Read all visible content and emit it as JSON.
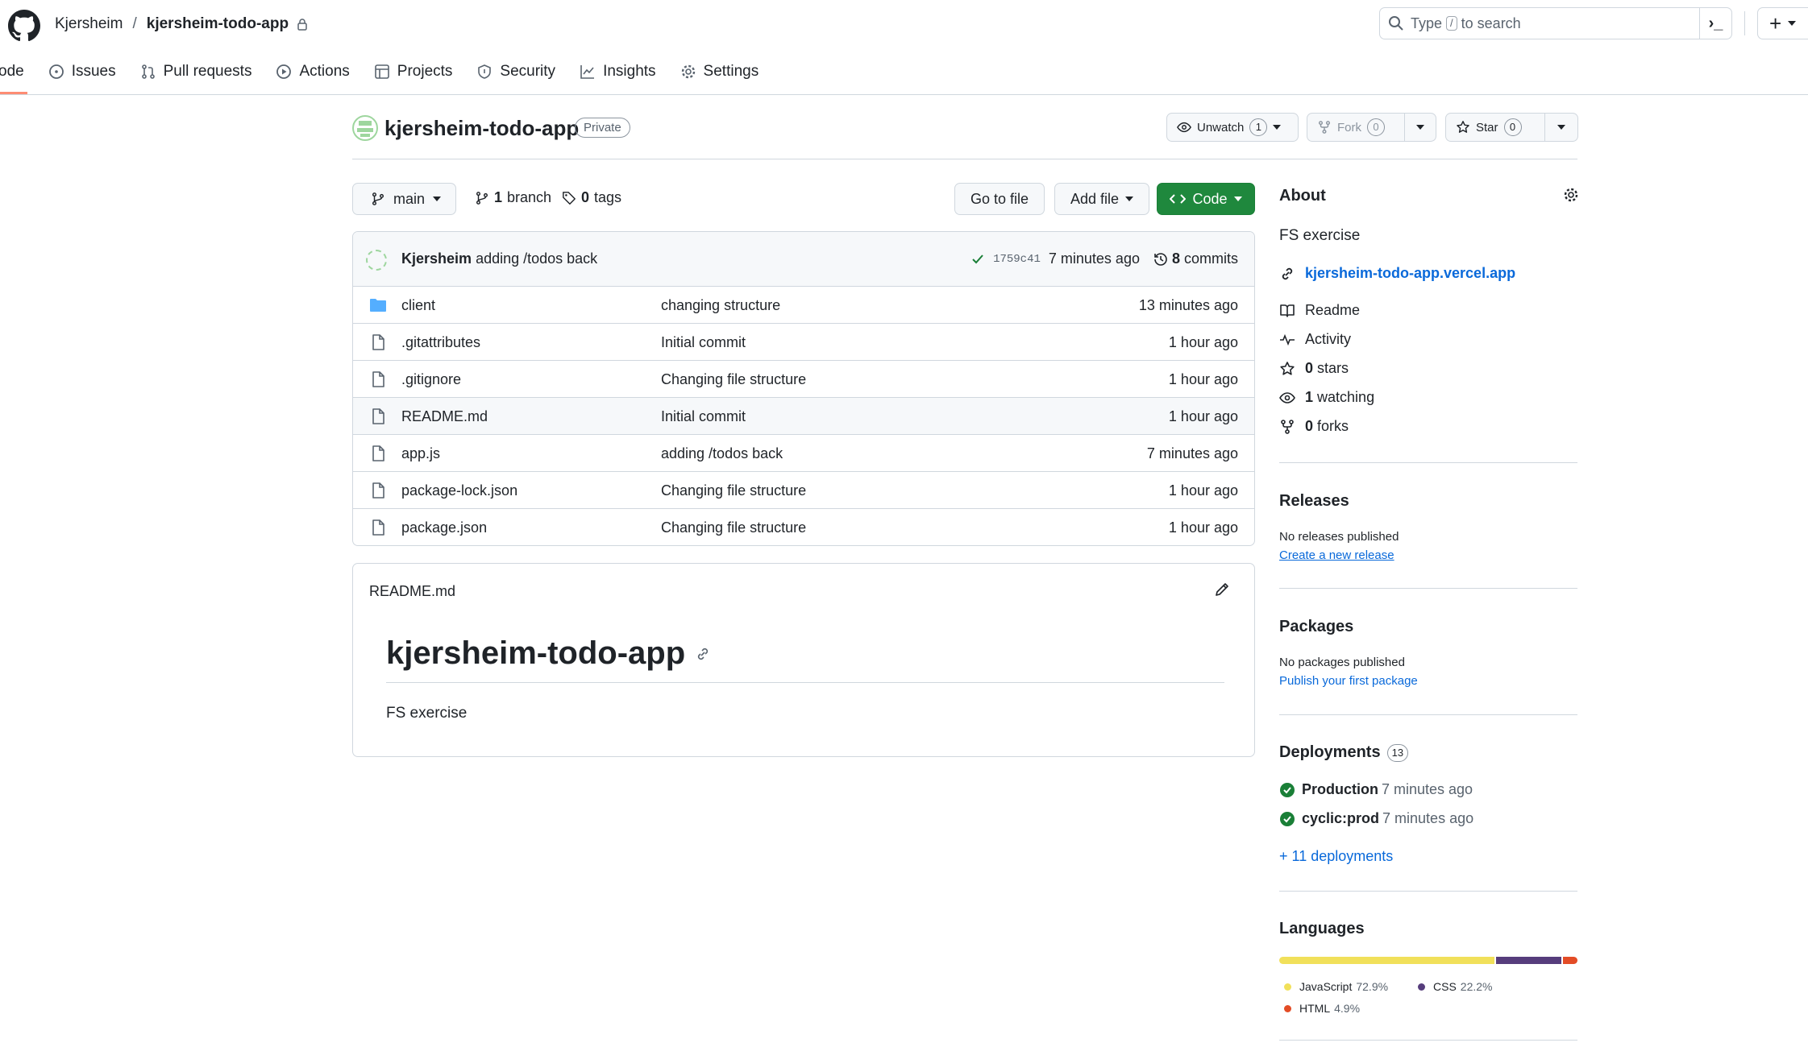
{
  "header": {
    "owner": "Kjersheim",
    "separator": "/",
    "repo": "kjersheim-todo-app",
    "search": {
      "prefix": "Type",
      "key": "/",
      "suffix": "to search"
    },
    "plus": "+"
  },
  "nav": {
    "tabs": [
      {
        "label": "ode",
        "icon": "code-icon"
      },
      {
        "label": "Issues",
        "icon": "issue-icon"
      },
      {
        "label": "Pull requests",
        "icon": "pull-request-icon"
      },
      {
        "label": "Actions",
        "icon": "play-icon"
      },
      {
        "label": "Projects",
        "icon": "table-icon"
      },
      {
        "label": "Security",
        "icon": "shield-icon"
      },
      {
        "label": "Insights",
        "icon": "graph-icon"
      },
      {
        "label": "Settings",
        "icon": "gear-icon"
      }
    ]
  },
  "repo": {
    "name": "kjersheim-todo-app",
    "visibility": "Private",
    "unwatch": {
      "label": "Unwatch",
      "count": "1"
    },
    "fork": {
      "label": "Fork",
      "count": "0"
    },
    "star": {
      "label": "Star",
      "count": "0"
    }
  },
  "toolbar": {
    "branch": "main",
    "branch_count": "1",
    "branch_label": "branch",
    "tag_count": "0",
    "tag_label": "tags",
    "go_to_file": "Go to file",
    "add_file": "Add file",
    "code": "Code"
  },
  "commit": {
    "author": "Kjersheim",
    "message": "adding /todos back",
    "sha": "1759c41",
    "time": "7 minutes ago",
    "commit_count": "8",
    "commit_label": "commits"
  },
  "files": [
    {
      "name": "client",
      "type": "folder",
      "message": "changing structure",
      "time": "13 minutes ago"
    },
    {
      "name": ".gitattributes",
      "type": "file",
      "message": "Initial commit",
      "time": "1 hour ago"
    },
    {
      "name": ".gitignore",
      "type": "file",
      "message": "Changing file structure",
      "time": "1 hour ago"
    },
    {
      "name": "README.md",
      "type": "file",
      "message": "Initial commit",
      "time": "1 hour ago"
    },
    {
      "name": "app.js",
      "type": "file",
      "message": "adding /todos back",
      "time": "7 minutes ago"
    },
    {
      "name": "package-lock.json",
      "type": "file",
      "message": "Changing file structure",
      "time": "1 hour ago"
    },
    {
      "name": "package.json",
      "type": "file",
      "message": "Changing file structure",
      "time": "1 hour ago"
    }
  ],
  "readme": {
    "filename": "README.md",
    "title": "kjersheim-todo-app",
    "body": "FS exercise"
  },
  "about": {
    "heading": "About",
    "description": "FS exercise",
    "link": "kjersheim-todo-app.vercel.app",
    "readme": "Readme",
    "activity": "Activity",
    "stars_count": "0",
    "stars_label": "stars",
    "watching_count": "1",
    "watching_label": "watching",
    "forks_count": "0",
    "forks_label": "forks"
  },
  "releases": {
    "heading": "Releases",
    "empty": "No releases published",
    "action": "Create a new release"
  },
  "packages": {
    "heading": "Packages",
    "empty": "No packages published",
    "action": "Publish your first package"
  },
  "deployments": {
    "heading": "Deployments",
    "count": "13",
    "items": [
      {
        "name": "Production",
        "time": "7 minutes ago"
      },
      {
        "name": "cyclic:prod",
        "time": "7 minutes ago"
      }
    ],
    "more": "+ 11 deployments"
  },
  "languages": {
    "heading": "Languages",
    "items": [
      {
        "name": "JavaScript",
        "percent": "72.9%",
        "value": 72.9,
        "color": "#f1e05a"
      },
      {
        "name": "CSS",
        "percent": "22.2%",
        "value": 22.2,
        "color": "#563d7c"
      },
      {
        "name": "HTML",
        "percent": "4.9%",
        "value": 4.9,
        "color": "#e34c26"
      }
    ]
  },
  "colors": {
    "accent": "#0969da",
    "green": "#1f883d",
    "tab_underline": "#fd8c73"
  }
}
